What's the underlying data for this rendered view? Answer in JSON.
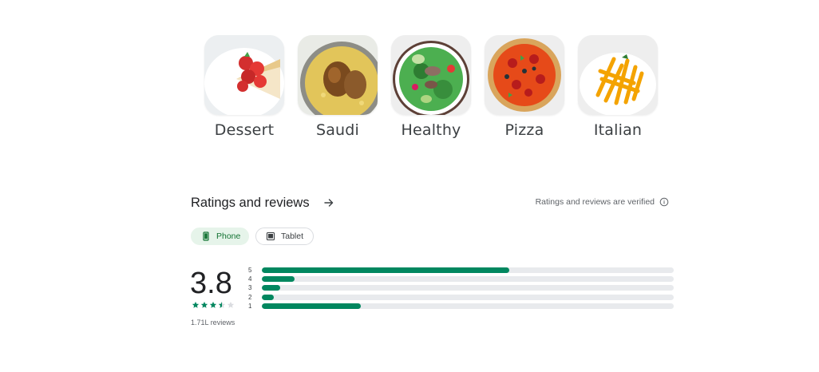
{
  "categories": [
    {
      "label": "Dessert",
      "icon": "dessert-image"
    },
    {
      "label": "Saudi",
      "icon": "saudi-dish-image"
    },
    {
      "label": "Healthy",
      "icon": "healthy-salad-image"
    },
    {
      "label": "Pizza",
      "icon": "pizza-image"
    },
    {
      "label": "Italian",
      "icon": "italian-pasta-image"
    }
  ],
  "ratings": {
    "title": "Ratings and reviews",
    "verified_text": "Ratings and reviews are verified",
    "devices": [
      {
        "label": "Phone",
        "selected": true,
        "icon": "phone-icon"
      },
      {
        "label": "Tablet",
        "selected": false,
        "icon": "tablet-icon"
      }
    ],
    "score": "3.8",
    "stars_value": 3.5,
    "review_count": "1.71L reviews",
    "histogram": [
      {
        "label": "5",
        "fraction": 0.6
      },
      {
        "label": "4",
        "fraction": 0.08
      },
      {
        "label": "3",
        "fraction": 0.045
      },
      {
        "label": "2",
        "fraction": 0.03
      },
      {
        "label": "1",
        "fraction": 0.24
      }
    ]
  },
  "colors": {
    "accent": "#01875f",
    "chip_selected_bg": "#e6f4ea",
    "track": "#e8eaed"
  }
}
